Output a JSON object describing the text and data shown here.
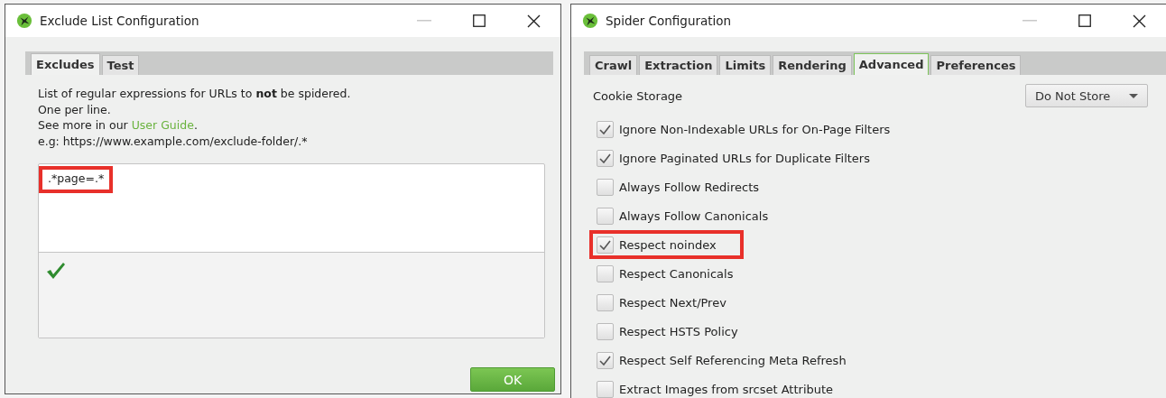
{
  "exclude_window": {
    "title": "Exclude List Configuration",
    "tabs": [
      {
        "label": "Excludes",
        "selected": true
      },
      {
        "label": "Test",
        "selected": false
      }
    ],
    "description": [
      "List of regular expressions for URLs to **not** be spidered.",
      "One per line."
    ],
    "guide_line": {
      "before": "See more in our ",
      "link": "User Guide",
      "after": "."
    },
    "example": "e.g: https://www.example.com/exclude-folder/.*",
    "excludes": [
      {
        "text": ".*page=.*",
        "highlighted": true
      }
    ],
    "ok_button": "OK"
  },
  "spider_window": {
    "title": "Spider Configuration",
    "tabs": [
      {
        "label": "Crawl",
        "selected": false
      },
      {
        "label": "Extraction",
        "selected": false
      },
      {
        "label": "Limits",
        "selected": false
      },
      {
        "label": "Rendering",
        "selected": false
      },
      {
        "label": "Advanced",
        "selected": true
      },
      {
        "label": "Preferences",
        "selected": false
      }
    ],
    "cookie_storage": {
      "label": "Cookie Storage",
      "value": "Do Not Store"
    },
    "options": [
      {
        "label": "Ignore Non-Indexable URLs for On-Page Filters",
        "checked": true,
        "highlighted": false
      },
      {
        "label": "Ignore Paginated URLs for Duplicate Filters",
        "checked": true,
        "highlighted": false
      },
      {
        "label": "Always Follow Redirects",
        "checked": false,
        "highlighted": false
      },
      {
        "label": "Always Follow Canonicals",
        "checked": false,
        "highlighted": false
      },
      {
        "label": "Respect noindex",
        "checked": true,
        "highlighted": true
      },
      {
        "label": "Respect Canonicals",
        "checked": false,
        "highlighted": false
      },
      {
        "label": "Respect Next/Prev",
        "checked": false,
        "highlighted": false
      },
      {
        "label": "Respect HSTS Policy",
        "checked": false,
        "highlighted": false
      },
      {
        "label": "Respect Self Referencing Meta Refresh",
        "checked": true,
        "highlighted": false
      },
      {
        "label": "Extract Images from srcset Attribute",
        "checked": false,
        "highlighted": false
      }
    ]
  }
}
